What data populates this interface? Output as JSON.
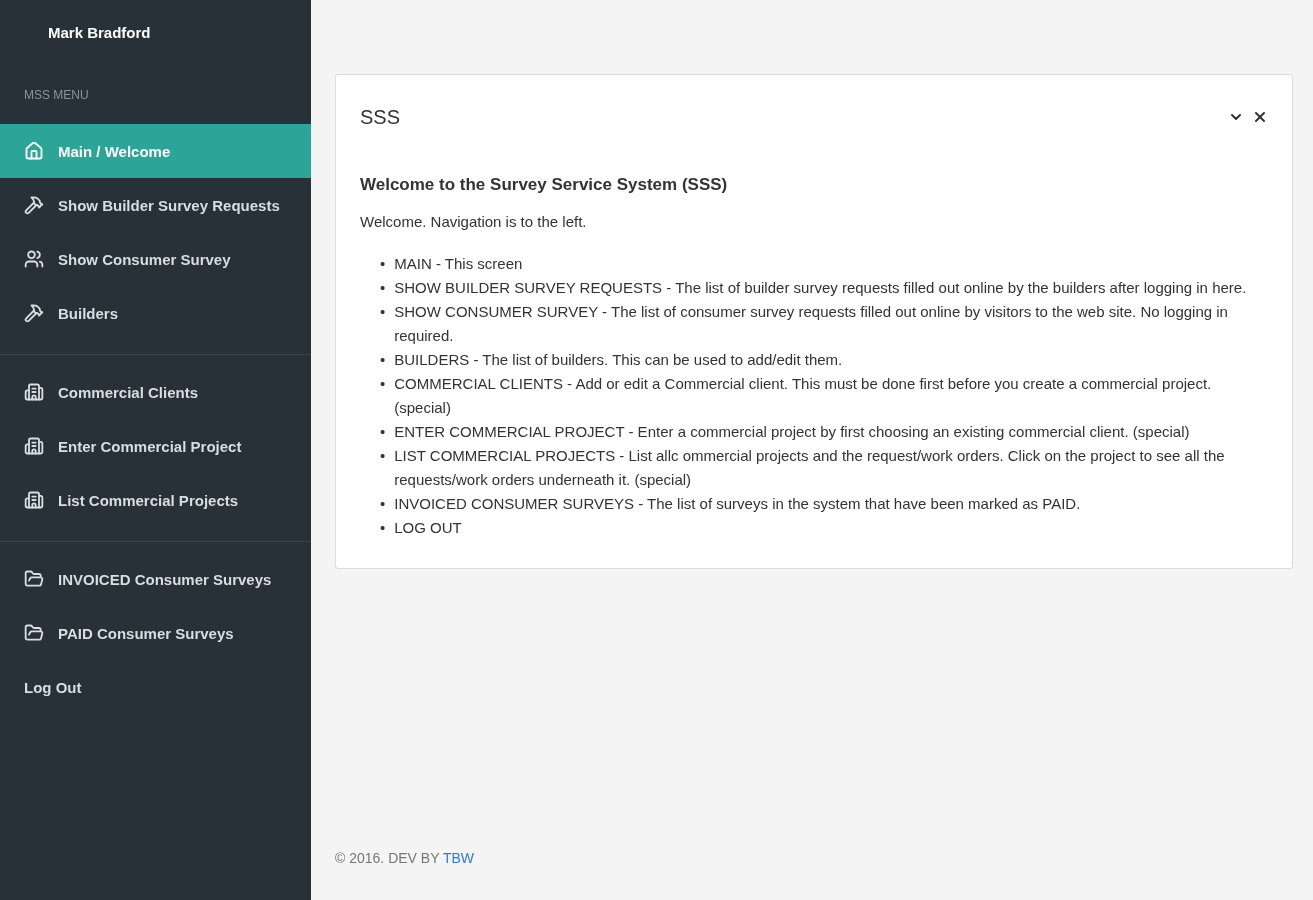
{
  "sidebar": {
    "user_name": "Mark Bradford",
    "menu_title": "MSS MENU",
    "groups": [
      {
        "items": [
          {
            "label": "Main / Welcome",
            "kind": "home",
            "selected": true
          },
          {
            "label": "Show Builder Survey Requests",
            "kind": "hammer",
            "selected": false
          },
          {
            "label": "Show Consumer Survey",
            "kind": "users",
            "selected": false
          },
          {
            "label": "Builders",
            "kind": "hammer",
            "selected": false
          }
        ]
      },
      {
        "items": [
          {
            "label": "Commercial Clients",
            "kind": "building",
            "selected": false
          },
          {
            "label": "Enter Commercial Project",
            "kind": "building",
            "selected": false
          },
          {
            "label": "List Commercial Projects",
            "kind": "building",
            "selected": false
          }
        ]
      },
      {
        "items": [
          {
            "label": "INVOICED Consumer Surveys",
            "kind": "folder",
            "selected": false
          },
          {
            "label": "PAID Consumer Surveys",
            "kind": "folder",
            "selected": false
          },
          {
            "label": "Log Out",
            "kind": "plain",
            "selected": false
          }
        ]
      }
    ]
  },
  "panel": {
    "title": "SSS",
    "heading": "Welcome to the Survey Service System (SSS)",
    "intro": "Welcome. Navigation is to the left.",
    "bullets": [
      {
        "marker": "•",
        "text": "MAIN - This screen"
      },
      {
        "marker": "•",
        "text": "SHOW BUILDER SURVEY REQUESTS - The list of builder survey requests filled out online by the builders after logging in here."
      },
      {
        "marker": "•",
        "text": "SHOW CONSUMER SURVEY - The list of consumer survey requests filled out online by visitors to the web site. No logging in required."
      },
      {
        "marker": "•",
        "text": "BUILDERS - The list of builders. This can be used to add/edit them."
      },
      {
        "marker": "•",
        "text": "COMMERCIAL CLIENTS - Add or edit a Commercial client. This must be done first before you create a commercial project. (special)"
      },
      {
        "marker": "•",
        "text": "ENTER COMMERCIAL PROJECT - Enter a commercial project by first choosing an existing commercial client. (special)"
      },
      {
        "marker": "•",
        "text": "LIST COMMERCIAL PROJECTS - List allc ommercial projects and the request/work orders. Click on the project to see all the requests/work orders underneath it. (special)"
      },
      {
        "marker": "•",
        "text": "INVOICED CONSUMER SURVEYS - The list of surveys in the system that have been marked as PAID."
      },
      {
        "marker": "•",
        "text": "LOG OUT"
      }
    ]
  },
  "footer": {
    "text": "© 2016. DEV BY ",
    "link": "TBW"
  }
}
